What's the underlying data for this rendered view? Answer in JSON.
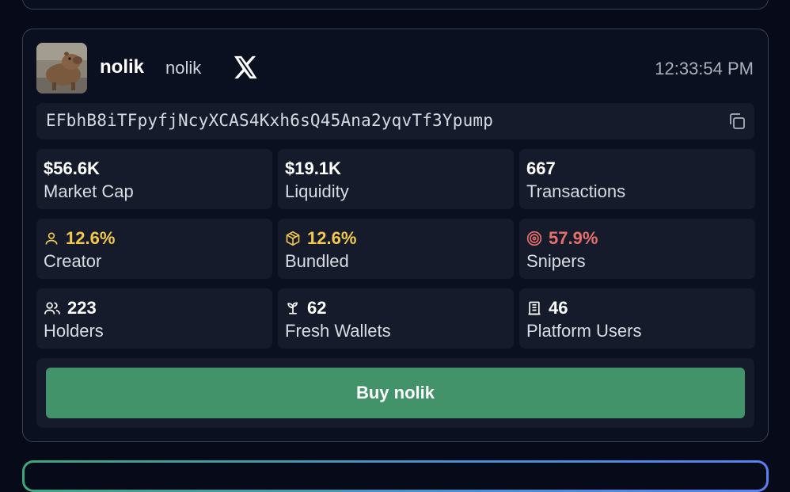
{
  "token": {
    "name": "nolik",
    "symbol": "nolik",
    "time": "12:33:54 PM",
    "contract_address": "EFbhB8iTFpyfjNcyXCAS4Kxh6sQ45Ana2yqvTf3Ypump"
  },
  "stats": {
    "market_cap": {
      "value": "$56.6K",
      "label": "Market Cap"
    },
    "liquidity": {
      "value": "$19.1K",
      "label": "Liquidity"
    },
    "transactions": {
      "value": "667",
      "label": "Transactions"
    },
    "creator": {
      "value": "12.6%",
      "label": "Creator",
      "icon": "user-icon"
    },
    "bundled": {
      "value": "12.6%",
      "label": "Bundled",
      "icon": "box-icon"
    },
    "snipers": {
      "value": "57.9%",
      "label": "Snipers",
      "icon": "target-icon"
    },
    "holders": {
      "value": "223",
      "label": "Holders",
      "icon": "users-icon"
    },
    "fresh_wallets": {
      "value": "62",
      "label": "Fresh Wallets",
      "icon": "sprout-icon"
    },
    "platform_users": {
      "value": "46",
      "label": "Platform Users",
      "icon": "building-icon"
    }
  },
  "buy_button": {
    "label": "Buy nolik"
  },
  "colors": {
    "accent_green": "#43936a",
    "warning_yellow": "#f2c94c",
    "danger_red": "#e8706b",
    "tile_bg": "#151b2b",
    "page_bg": "#060a19"
  }
}
